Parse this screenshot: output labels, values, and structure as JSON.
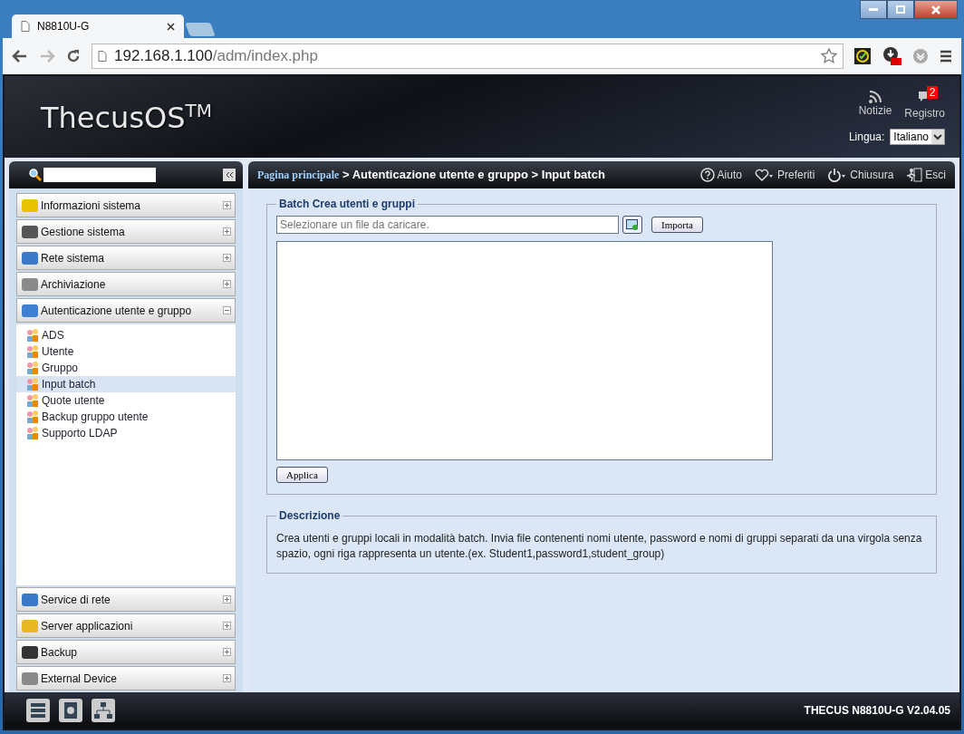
{
  "browser": {
    "tab_title": "N8810U-G",
    "url_host": "192.168.1.100",
    "url_path": "/adm/index.php"
  },
  "header": {
    "logo": "ThecusOS",
    "logo_mark": "TM",
    "news_label": "Notizie",
    "log_label": "Registro",
    "log_badge": "2",
    "language_label": "Lingua:",
    "language_value": "Italiano"
  },
  "sidebar": {
    "groups_top": [
      {
        "label": "Informazioni sistema",
        "expanded": false,
        "color": "#e8c400"
      },
      {
        "label": "Gestione sistema",
        "expanded": false,
        "color": "#555555"
      },
      {
        "label": "Rete sistema",
        "expanded": false,
        "color": "#3a78c8"
      },
      {
        "label": "Archiviazione",
        "expanded": false,
        "color": "#8a8a8a"
      },
      {
        "label": "Autenticazione utente e gruppo",
        "expanded": true,
        "color": "#3d7fd0",
        "children": [
          {
            "label": "ADS",
            "selected": false
          },
          {
            "label": "Utente",
            "selected": false
          },
          {
            "label": "Gruppo",
            "selected": false
          },
          {
            "label": "Input batch",
            "selected": true
          },
          {
            "label": "Quote utente",
            "selected": false
          },
          {
            "label": "Backup gruppo utente",
            "selected": false
          },
          {
            "label": "Supporto LDAP",
            "selected": false
          }
        ]
      }
    ],
    "groups_bottom": [
      {
        "label": "Service di rete",
        "expanded": false,
        "color": "#3a78c8"
      },
      {
        "label": "Server applicazioni",
        "expanded": false,
        "color": "#e8b820"
      },
      {
        "label": "Backup",
        "expanded": false,
        "color": "#333333"
      },
      {
        "label": "External Device",
        "expanded": false,
        "color": "#8a8a8a"
      }
    ]
  },
  "breadcrumb": {
    "home": "Pagina principale",
    "path": "> Autenticazione utente e gruppo > Input batch"
  },
  "top_actions": [
    {
      "label": "Aiuto",
      "kind": "help"
    },
    {
      "label": "Preferiti",
      "kind": "favorite"
    },
    {
      "label": "Chiusura",
      "kind": "power"
    },
    {
      "label": "Esci",
      "kind": "exit"
    }
  ],
  "batch": {
    "legend": "Batch Crea utenti e gruppi",
    "file_placeholder": "Selezionare un file da caricare.",
    "import_button": "Importa",
    "apply_button": "Applica"
  },
  "description": {
    "legend": "Descrizione",
    "text": "Crea utenti e gruppi locali in modalità batch. Invia file contenenti nomi utente, password e nomi di gruppi separati da una virgola senza spazio, ogni riga rappresenta un utente.(ex. Student1,password1,student_group)"
  },
  "footer": {
    "version": "THECUS N8810U-G V2.04.05"
  }
}
